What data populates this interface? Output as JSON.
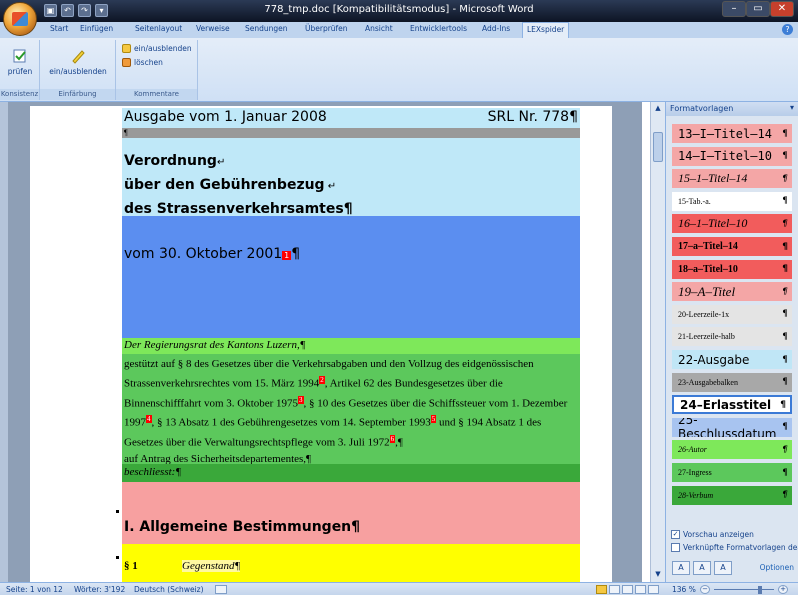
{
  "window": {
    "title": "778_tmp.doc [Kompatibilitätsmodus] - Microsoft Word",
    "controls": [
      "–",
      "▭",
      "✕"
    ]
  },
  "tabs": [
    "Start",
    "Einfügen",
    "Seitenlayout",
    "Verweise",
    "Sendungen",
    "Überprüfen",
    "Ansicht",
    "Entwicklertools",
    "Add-Ins",
    "LEXspider"
  ],
  "ribbon": {
    "groups": {
      "konsistenz": {
        "label": "Konsistenz",
        "button": "prüfen"
      },
      "einfaerbung": {
        "label": "Einfärbung",
        "button": "ein/ausblenden"
      },
      "kommentare": {
        "label": "Kommentare",
        "btn1": "ein/ausblenden",
        "btn2": "löschen"
      }
    }
  },
  "document": {
    "header_left": "Ausgabe vom 1. Januar 2008",
    "header_right": "SRL Nr. 778¶",
    "pilcrow": "¶",
    "title1": "Verordnung",
    "title2": "über den Gebührenbezug",
    "title3": "des Strassenverkehrsamtes¶",
    "date": "vom 30. Oktober 2001",
    "fn1": "1",
    "date_end": "¶",
    "author": "Der Regierungsrat des Kantons Luzern,¶",
    "ingress": {
      "t1": "gestützt auf § 8 des Gesetzes über die Verkehrsabgaben und den Vollzug des eidgenössischen Strassenverkehrsrechtes vom 15. März 1994",
      "f1": "2",
      "t2": ", Artikel 62 des Bundesgesetzes über die Binnenschifffahrt vom 3. Oktober 1975",
      "f2": "3",
      "t3": ", § 10 des Gesetzes über die Schiffssteuer vom 1. Dezember 1997",
      "f3": "4",
      "t4": ", § 13 Absatz 1 des Gebührengesetzes vom 14. September 1993",
      "f4": "5",
      "t5": " und § 194 Absatz 1 des Gesetzes über die Verwaltungsrechtspflege vom 3. Juli 1972",
      "f5": "6",
      "t6": ",¶",
      "t7": "auf Antrag des Sicherheitsdepartementes,¶"
    },
    "verbum": "beschliesst:¶",
    "section": "I. Allgemeine Bestimmungen¶",
    "para_num": "§ 1",
    "para_title": "Gegenstand¶"
  },
  "styles_pane": {
    "title": "Formatvorlagen",
    "items": [
      {
        "label": "13–I–Titel–14",
        "color": "#f4a6a6"
      },
      {
        "label": "14–I–Titel–10",
        "color": "#f4a6a6"
      },
      {
        "label": "15–1–Titel–14",
        "color": "#f4a6a6"
      },
      {
        "label": "15-Tab.-a.",
        "color": "#ffffff"
      },
      {
        "label": "16–1–Titel–10",
        "color": "#f25c5c"
      },
      {
        "label": "17–a–Titel–14",
        "color": "#f25c5c"
      },
      {
        "label": "18–a–Titel–10",
        "color": "#f25c5c"
      },
      {
        "label": "19–A–Titel",
        "color": "#f4a6a6"
      },
      {
        "label": "20-Leerzeile-1x",
        "color": "#e4e4e4"
      },
      {
        "label": "21-Leerzeile-halb",
        "color": "#e4e4e4"
      },
      {
        "label": "22-Ausgabe",
        "color": "#c0e6f6"
      },
      {
        "label": "23-Ausgabebalken",
        "color": "#a8a8a8"
      },
      {
        "label": "24–Erlasstitel",
        "color": "#ffffff"
      },
      {
        "label": "25-Beschlussdatum",
        "color": "#a8c4f0"
      },
      {
        "label": "26-Autor",
        "color": "#7ee85a"
      },
      {
        "label": "27-Ingress",
        "color": "#5cc85c"
      },
      {
        "label": "28-Verbum",
        "color": "#3aa83a"
      }
    ],
    "pilcrow": "¶",
    "check1": "Vorschau anzeigen",
    "check1_mark": "✓",
    "check2": "Verknüpfte Formatvorlagen dea",
    "options": "Optionen"
  },
  "status": {
    "page": "Seite: 1 von 12",
    "words": "Wörter: 3'192",
    "lang": "Deutsch (Schweiz)",
    "zoom": "136 %"
  }
}
